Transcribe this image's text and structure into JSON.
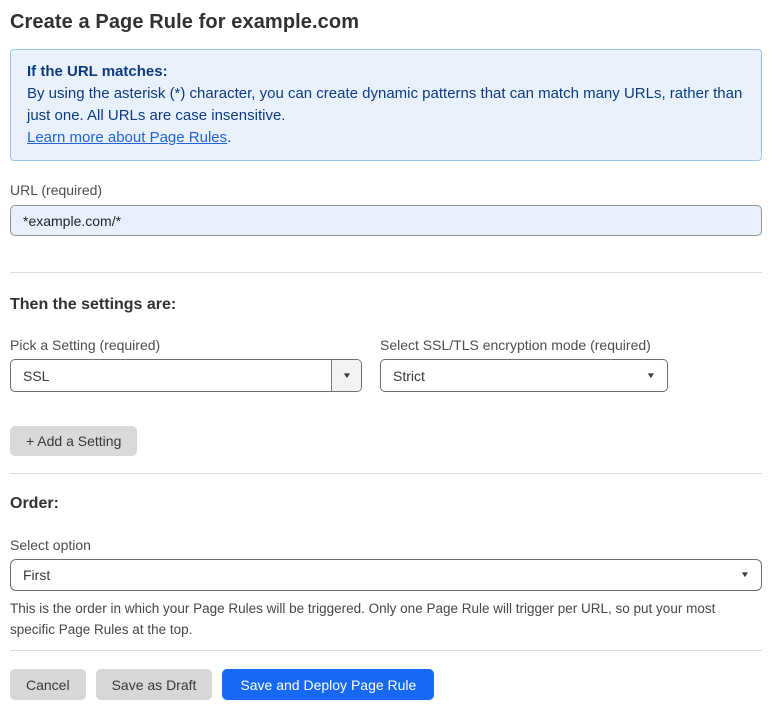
{
  "page": {
    "title": "Create a Page Rule for example.com"
  },
  "info_box": {
    "heading": "If the URL matches:",
    "body": "By using the asterisk (*) character, you can create dynamic patterns that can match many URLs, rather than just one. All URLs are case insensitive.",
    "link_label": "Learn more about Page Rules",
    "link_suffix": "."
  },
  "url_field": {
    "label": "URL (required)",
    "value": "*example.com/*"
  },
  "settings": {
    "heading": "Then the settings are:",
    "setting_picker": {
      "label": "Pick a Setting (required)",
      "value": "SSL"
    },
    "ssl_mode": {
      "label": "Select SSL/TLS encryption mode (required)",
      "value": "Strict"
    },
    "add_setting_label": "+ Add a Setting"
  },
  "order": {
    "heading": "Order:",
    "label": "Select option",
    "value": "First",
    "help": "This is the order in which your Page Rules will be triggered. Only one Page Rule will trigger per URL, so put your most specific Page Rules at the top."
  },
  "footer": {
    "cancel_label": "Cancel",
    "save_draft_label": "Save as Draft",
    "save_deploy_label": "Save and Deploy Page Rule"
  },
  "icons": {
    "dropdown_arrow": "▼"
  },
  "colors": {
    "accent_blue": "#1768f2",
    "info_bg": "#e9f2fc",
    "info_border": "#9cc5ec",
    "info_text": "#0e3b80",
    "link_blue": "#2164d2",
    "input_bg": "#e8f0fe",
    "button_gray": "#d7d7d7"
  }
}
